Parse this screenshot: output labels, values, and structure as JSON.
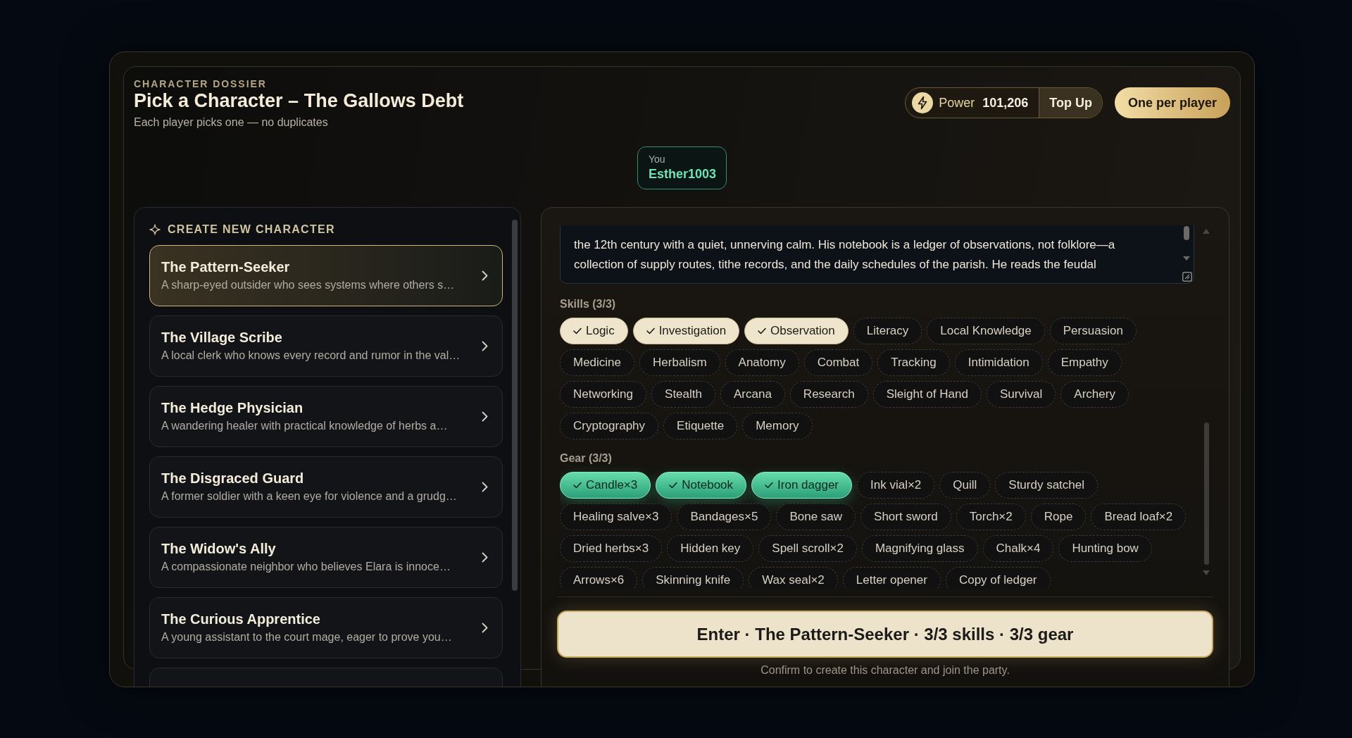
{
  "dialog": {
    "eyebrow": "CHARACTER DOSSIER",
    "title": "Pick a Character – The Gallows Debt",
    "subtitle": "Each player picks one — no duplicates"
  },
  "power": {
    "label": "Power",
    "value": "101,206",
    "action": "Top Up"
  },
  "rule_badge": "One per player",
  "player": {
    "label": "You",
    "name": "Esther1003"
  },
  "character_list": {
    "heading": "CREATE NEW CHARACTER",
    "items": [
      {
        "title": "The Pattern-Seeker",
        "description": "A sharp-eyed outsider who sees systems where others s…",
        "selected": true
      },
      {
        "title": "The Village Scribe",
        "description": "A local clerk who knows every record and rumor in the val…",
        "selected": false
      },
      {
        "title": "The Hedge Physician",
        "description": "A wandering healer with practical knowledge of herbs a…",
        "selected": false
      },
      {
        "title": "The Disgraced Guard",
        "description": "A former soldier with a keen eye for violence and a grudg…",
        "selected": false
      },
      {
        "title": "The Widow's Ally",
        "description": "A compassionate neighbor who believes Elara is innoce…",
        "selected": false
      },
      {
        "title": "The Curious Apprentice",
        "description": "A young assistant to the court mage, eager to prove you…",
        "selected": false
      },
      {
        "selected": false
      }
    ]
  },
  "details": {
    "description": "the 12th century with a quiet, unnerving calm. His notebook is a ledger of observations, not folklore—a collection of supply routes, tithe records, and the daily schedules of the parish. He reads the feudal",
    "skills": {
      "label": "Skills (3/3)",
      "options": [
        {
          "label": "Logic",
          "selected": true
        },
        {
          "label": "Investigation",
          "selected": true
        },
        {
          "label": "Observation",
          "selected": true
        },
        {
          "label": "Literacy",
          "selected": false
        },
        {
          "label": "Local Knowledge",
          "selected": false
        },
        {
          "label": "Persuasion",
          "selected": false
        },
        {
          "label": "Medicine",
          "selected": false
        },
        {
          "label": "Herbalism",
          "selected": false
        },
        {
          "label": "Anatomy",
          "selected": false
        },
        {
          "label": "Combat",
          "selected": false
        },
        {
          "label": "Tracking",
          "selected": false
        },
        {
          "label": "Intimidation",
          "selected": false
        },
        {
          "label": "Empathy",
          "selected": false
        },
        {
          "label": "Networking",
          "selected": false
        },
        {
          "label": "Stealth",
          "selected": false
        },
        {
          "label": "Arcana",
          "selected": false
        },
        {
          "label": "Research",
          "selected": false
        },
        {
          "label": "Sleight of Hand",
          "selected": false
        },
        {
          "label": "Survival",
          "selected": false
        },
        {
          "label": "Archery",
          "selected": false
        },
        {
          "label": "Cryptography",
          "selected": false
        },
        {
          "label": "Etiquette",
          "selected": false
        },
        {
          "label": "Memory",
          "selected": false
        }
      ]
    },
    "gear": {
      "label": "Gear (3/3)",
      "options": [
        {
          "label": "Candle×3",
          "selected": true
        },
        {
          "label": "Notebook",
          "selected": true
        },
        {
          "label": "Iron dagger",
          "selected": true
        },
        {
          "label": "Ink vial×2",
          "selected": false
        },
        {
          "label": "Quill",
          "selected": false
        },
        {
          "label": "Sturdy satchel",
          "selected": false
        },
        {
          "label": "Healing salve×3",
          "selected": false
        },
        {
          "label": "Bandages×5",
          "selected": false
        },
        {
          "label": "Bone saw",
          "selected": false
        },
        {
          "label": "Short sword",
          "selected": false
        },
        {
          "label": "Torch×2",
          "selected": false
        },
        {
          "label": "Rope",
          "selected": false
        },
        {
          "label": "Bread loaf×2",
          "selected": false
        },
        {
          "label": "Dried herbs×3",
          "selected": false
        },
        {
          "label": "Hidden key",
          "selected": false
        },
        {
          "label": "Spell scroll×2",
          "selected": false
        },
        {
          "label": "Magnifying glass",
          "selected": false
        },
        {
          "label": "Chalk×4",
          "selected": false
        },
        {
          "label": "Hunting bow",
          "selected": false
        },
        {
          "label": "Arrows×6",
          "selected": false
        },
        {
          "label": "Skinning knife",
          "selected": false
        },
        {
          "label": "Wax seal×2",
          "selected": false
        },
        {
          "label": "Letter opener",
          "selected": false
        },
        {
          "label": "Copy of ledger",
          "selected": false
        }
      ]
    }
  },
  "confirm": {
    "label": "Enter · The Pattern-Seeker · 3/3 skills · 3/3 gear",
    "note": "Confirm to create this character and join the party."
  }
}
